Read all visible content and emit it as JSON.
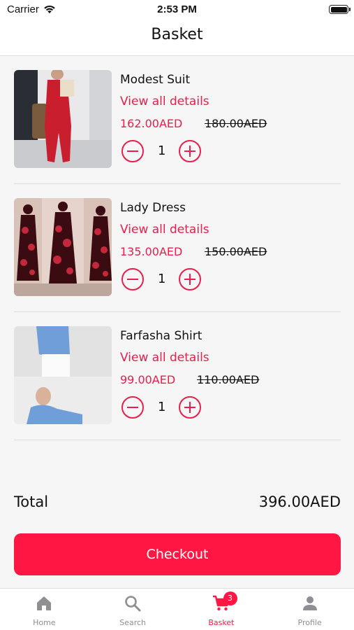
{
  "status_bar": {
    "carrier": "Carrier",
    "time": "2:53 PM"
  },
  "nav": {
    "title": "Basket"
  },
  "items": [
    {
      "name": "Modest Suit",
      "details_link": "View all details",
      "price": "162.00AED",
      "old_price": "180.00AED",
      "quantity": "1"
    },
    {
      "name": "Lady Dress",
      "details_link": "View all details",
      "price": "135.00AED",
      "old_price": "150.00AED",
      "quantity": "1"
    },
    {
      "name": "Farfasha Shirt",
      "details_link": "View all details",
      "price": "99.00AED",
      "old_price": "110.00AED",
      "quantity": "1"
    }
  ],
  "total": {
    "label": "Total",
    "value": "396.00AED"
  },
  "checkout": {
    "label": "Checkout"
  },
  "tabs": [
    {
      "label": "Home",
      "icon": "home-icon",
      "active": false
    },
    {
      "label": "Search",
      "icon": "search-icon",
      "active": false
    },
    {
      "label": "Basket",
      "icon": "cart-icon",
      "active": true,
      "badge": "3"
    },
    {
      "label": "Profile",
      "icon": "person-icon",
      "active": false
    }
  ],
  "colors": {
    "accent": "#e91e4a",
    "button": "#ff1744",
    "inactive_tab": "#8e8e93"
  }
}
